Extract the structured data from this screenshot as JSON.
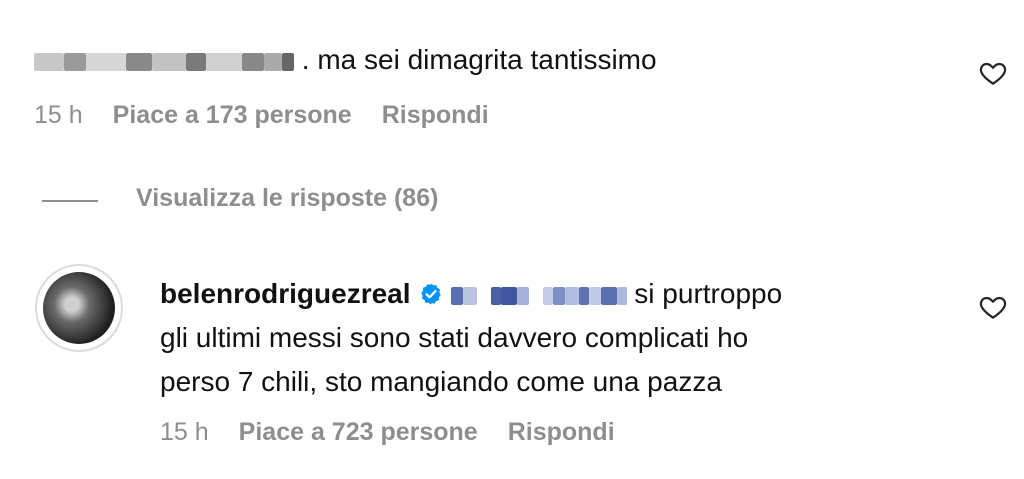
{
  "comment1": {
    "text": ". ma sei dimagrita tantissimo",
    "time": "15 h",
    "likes": "Piace a 173 persone",
    "reply": "Rispondi"
  },
  "replies": {
    "label": "Visualizza le risposte (86)"
  },
  "comment2": {
    "username": "belenrodriguezreal",
    "text_line1": " si purtroppo",
    "text_line2": "gli ultimi messi sono stati davvero complicati ho",
    "text_line3": "perso 7 chili, sto mangiando come una pazza",
    "time": "15 h",
    "likes": "Piace a 723 persone",
    "reply": "Rispondi"
  },
  "colors": {
    "meta_gray": "#8e8e8e",
    "verified_blue": "#0095f6",
    "text": "#111111"
  },
  "icons": [
    "heart-icon",
    "verified-badge-icon"
  ]
}
